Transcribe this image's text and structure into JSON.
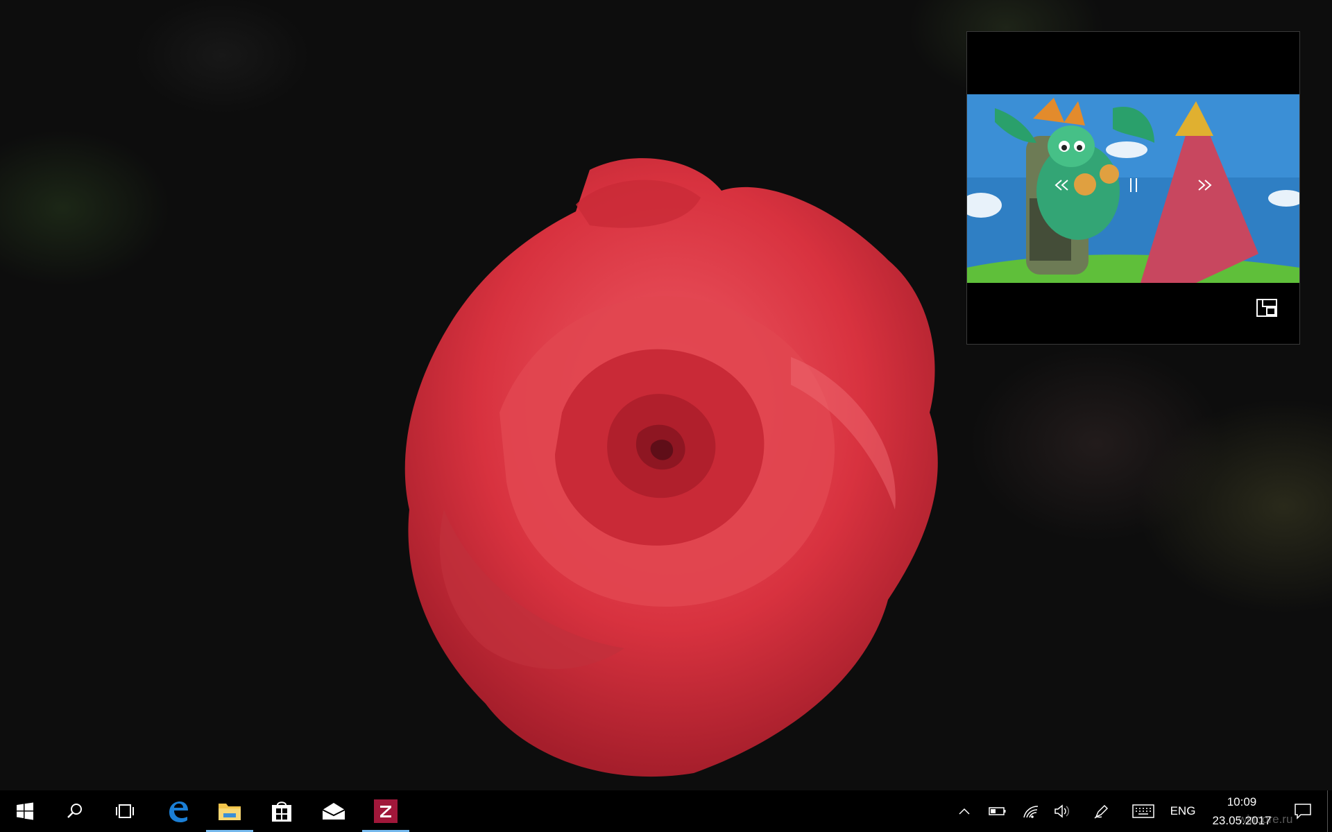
{
  "desktop": {
    "wallpaper_subject": "rose-wallpaper",
    "colors": {
      "rose": "#d8323f",
      "background": "#0d0d0d"
    }
  },
  "pip_player": {
    "icons": {
      "rewind": "rewind-icon",
      "pause": "pause-icon",
      "fast_forward": "fast-forward-icon",
      "overlay_toggle": "compact-overlay-icon"
    },
    "state": "playing"
  },
  "taskbar": {
    "start_icon": "windows-logo-icon",
    "search_icon": "search-icon",
    "task_view_icon": "task-view-icon",
    "pinned_apps": [
      {
        "name": "Microsoft Edge",
        "icon": "edge-icon",
        "running": false
      },
      {
        "name": "File Explorer",
        "icon": "folder-icon",
        "running": true
      },
      {
        "name": "Microsoft Store",
        "icon": "store-icon",
        "running": false
      },
      {
        "name": "Mail",
        "icon": "mail-icon",
        "running": false
      },
      {
        "name": "Video app",
        "icon": "z-app-icon",
        "running": true
      }
    ],
    "tray": {
      "language": "ENG",
      "time": "10:09",
      "date": "23.05.2017",
      "watermark": "wincore.ru"
    },
    "accent": "#76b9ed"
  }
}
